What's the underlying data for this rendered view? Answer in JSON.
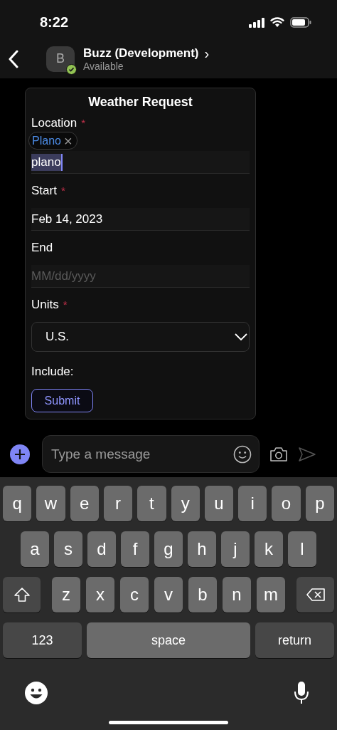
{
  "status_bar": {
    "time": "8:22"
  },
  "header": {
    "avatar_initial": "B",
    "name": "Buzz (Development)",
    "chevron": "›",
    "presence": "Available",
    "online": true
  },
  "card": {
    "title": "Weather Request",
    "required_mark": "*",
    "fields": [
      {
        "kind": "text",
        "label": "Location",
        "required": true,
        "value": "plano",
        "highlighted": true,
        "suggestion": {
          "text": "Plano",
          "close": "×"
        }
      },
      {
        "kind": "date",
        "label": "Start",
        "required": true,
        "value": "Feb 14, 2023"
      },
      {
        "kind": "date",
        "label": "End",
        "required": false,
        "placeholder": "MM/dd/yyyy"
      },
      {
        "kind": "select",
        "label": "Units",
        "required": true,
        "value": "U.S."
      },
      {
        "kind": "heading",
        "label": "Include:"
      }
    ],
    "submit": "Submit"
  },
  "composer": {
    "placeholder": "Type a message",
    "send_enabled": false
  },
  "keyboard": {
    "rows": [
      {
        "keys": [
          {
            "kind": "letter",
            "label": "q"
          },
          {
            "kind": "letter",
            "label": "w"
          },
          {
            "kind": "letter",
            "label": "e"
          },
          {
            "kind": "letter",
            "label": "r"
          },
          {
            "kind": "letter",
            "label": "t"
          },
          {
            "kind": "letter",
            "label": "y"
          },
          {
            "kind": "letter",
            "label": "u"
          },
          {
            "kind": "letter",
            "label": "i"
          },
          {
            "kind": "letter",
            "label": "o"
          },
          {
            "kind": "letter",
            "label": "p"
          }
        ]
      },
      {
        "keys": [
          {
            "kind": "letter",
            "label": "a"
          },
          {
            "kind": "letter",
            "label": "s"
          },
          {
            "kind": "letter",
            "label": "d"
          },
          {
            "kind": "letter",
            "label": "f"
          },
          {
            "kind": "letter",
            "label": "g"
          },
          {
            "kind": "letter",
            "label": "h"
          },
          {
            "kind": "letter",
            "label": "j"
          },
          {
            "kind": "letter",
            "label": "k"
          },
          {
            "kind": "letter",
            "label": "l"
          }
        ]
      },
      {
        "keys": [
          {
            "kind": "shift"
          },
          {
            "kind": "letter",
            "label": "z"
          },
          {
            "kind": "letter",
            "label": "x"
          },
          {
            "kind": "letter",
            "label": "c"
          },
          {
            "kind": "letter",
            "label": "v"
          },
          {
            "kind": "letter",
            "label": "b"
          },
          {
            "kind": "letter",
            "label": "n"
          },
          {
            "kind": "letter",
            "label": "m"
          },
          {
            "kind": "backspace"
          }
        ]
      },
      {
        "keys": [
          {
            "kind": "mode",
            "label": "123"
          },
          {
            "kind": "space",
            "label": "space"
          },
          {
            "kind": "return",
            "label": "return"
          }
        ]
      }
    ]
  }
}
